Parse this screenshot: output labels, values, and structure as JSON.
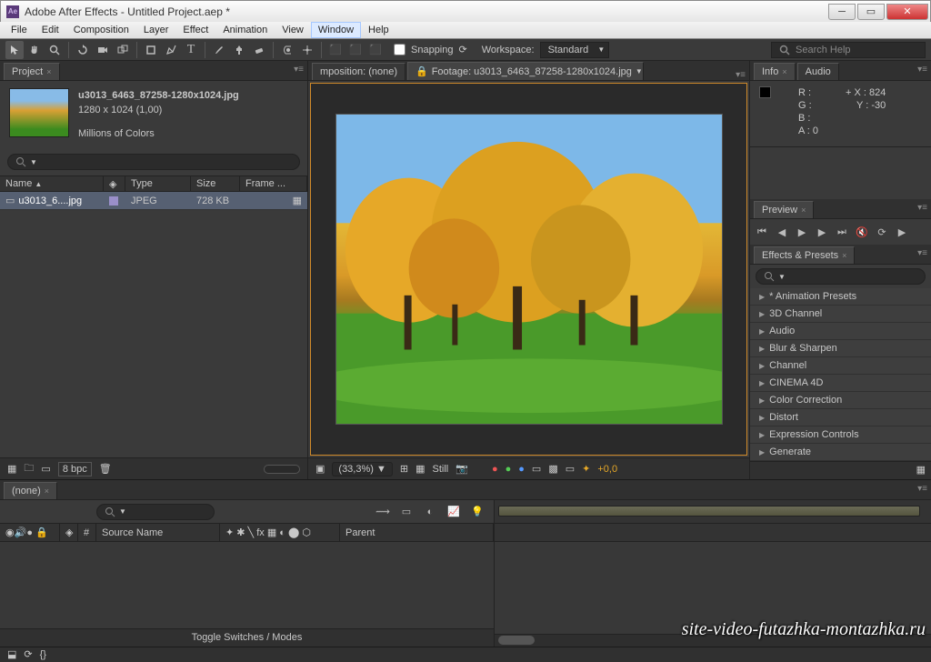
{
  "window": {
    "title": "Adobe After Effects - Untitled Project.aep *"
  },
  "menu": [
    "File",
    "Edit",
    "Composition",
    "Layer",
    "Effect",
    "Animation",
    "View",
    "Window",
    "Help"
  ],
  "menu_active": "Window",
  "toolbar": {
    "snapping_label": "Snapping",
    "workspace_label": "Workspace:",
    "workspace_value": "Standard",
    "search_placeholder": "Search Help"
  },
  "project": {
    "tab": "Project",
    "asset_name": "u3013_6463_87258-1280x1024.jpg",
    "asset_dims": "1280 x 1024 (1,00)",
    "asset_colors": "Millions of Colors",
    "cols": {
      "name": "Name",
      "type": "Type",
      "size": "Size",
      "frame": "Frame ..."
    },
    "row": {
      "name": "u3013_6....jpg",
      "type": "JPEG",
      "size": "728 KB"
    },
    "bpc": "8 bpc"
  },
  "viewer": {
    "tab_comp": "mposition: (none)",
    "tab_footage": "Footage: u3013_6463_87258-1280x1024.jpg",
    "zoom": "(33,3%)",
    "still": "Still",
    "exposure": "+0,0"
  },
  "info": {
    "tab1": "Info",
    "tab2": "Audio",
    "r": "R :",
    "g": "G :",
    "b": "B :",
    "a": "A :  0",
    "x": "X : 824",
    "y": "Y : -30"
  },
  "preview": {
    "tab": "Preview"
  },
  "effects": {
    "tab": "Effects & Presets",
    "items": [
      "* Animation Presets",
      "3D Channel",
      "Audio",
      "Blur & Sharpen",
      "Channel",
      "CINEMA 4D",
      "Color Correction",
      "Distort",
      "Expression Controls",
      "Generate"
    ]
  },
  "timeline": {
    "tab": "(none)",
    "col_num": "#",
    "col_source": "Source Name",
    "col_parent": "Parent",
    "toggle": "Toggle Switches / Modes"
  },
  "watermark": "site-video-futazhka-montazhka.ru"
}
